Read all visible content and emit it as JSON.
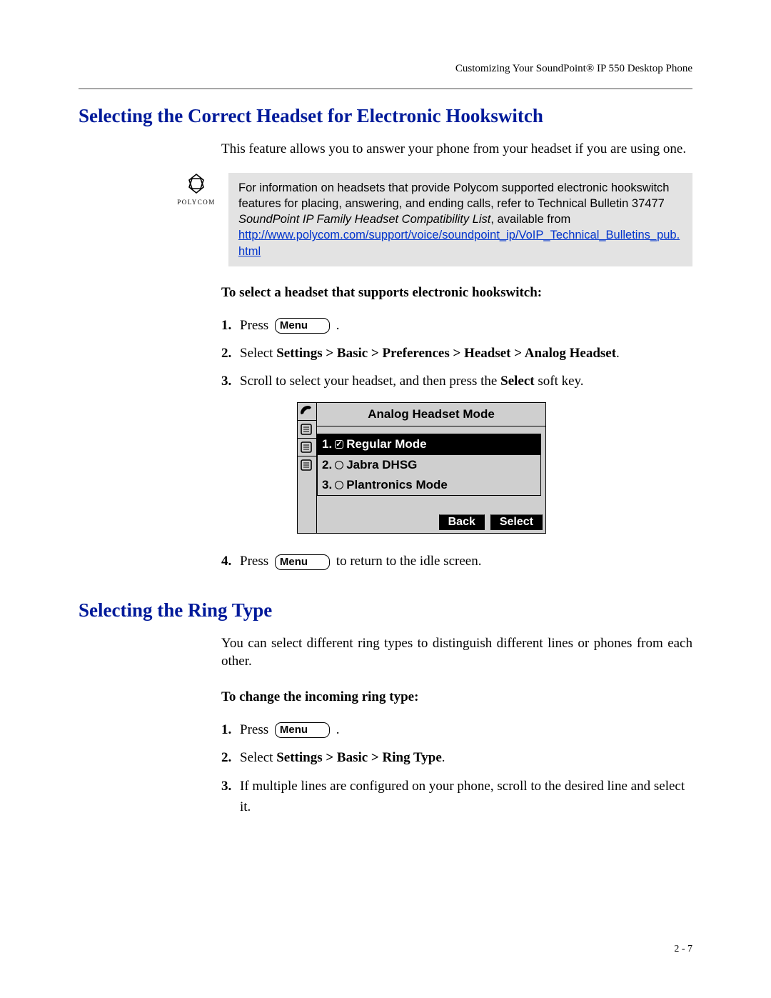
{
  "running_head": "Customizing Your SoundPoint® IP 550 Desktop Phone",
  "page_number": "2 - 7",
  "menu_key_label": "Menu",
  "logo_brand": "POLYCOM",
  "section1": {
    "title": "Selecting the Correct Headset for Electronic Hookswitch",
    "intro": "This feature allows you to answer your phone from your headset if you are using one.",
    "note_text_1": "For information on headsets that provide Polycom supported electronic hookswitch features for placing, answering, and ending calls, refer to Technical Bulletin 37477 ",
    "note_italic": "SoundPoint IP Family Headset Compatibility List",
    "note_text_2": ", available from",
    "note_link": "http://www.polycom.com/support/voice/soundpoint_ip/VoIP_Technical_Bulletins_pub.html",
    "sub_heading": "To select a headset that supports electronic hookswitch:",
    "steps": {
      "s1_pre": "Press ",
      "s1_post": " .",
      "s2_pre": "Select ",
      "s2_bold": "Settings > Basic > Preferences > Headset > Analog Headset",
      "s2_post": ".",
      "s3_pre": "Scroll to select your headset, and then press the ",
      "s3_bold": "Select",
      "s3_post": " soft key.",
      "s4_pre": "Press ",
      "s4_post": " to return to the idle screen."
    },
    "phone": {
      "title": "Analog Headset Mode",
      "items": [
        {
          "n": "1.",
          "label": "Regular Mode",
          "selected": true,
          "checked": true
        },
        {
          "n": "2.",
          "label": "Jabra DHSG",
          "selected": false,
          "checked": false
        },
        {
          "n": "3.",
          "label": "Plantronics Mode",
          "selected": false,
          "checked": false
        }
      ],
      "softkeys": {
        "back": "Back",
        "select": "Select"
      }
    }
  },
  "section2": {
    "title": "Selecting the Ring Type",
    "intro": "You can select different ring types to distinguish different lines or phones from each other.",
    "sub_heading": "To change the incoming ring type:",
    "steps": {
      "s1_pre": "Press ",
      "s1_post": " .",
      "s2_pre": "Select ",
      "s2_bold": "Settings > Basic > Ring Type",
      "s2_post": ".",
      "s3": "If multiple lines are configured on your phone, scroll to the desired line and select it."
    }
  }
}
